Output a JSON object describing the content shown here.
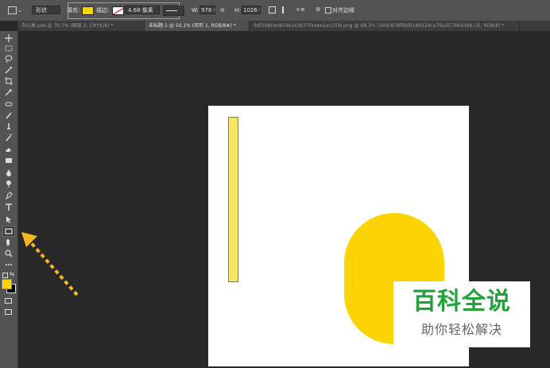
{
  "options_bar": {
    "shape_mode": "形状",
    "fill_label": "填充:",
    "fill_color": "#fcd404",
    "stroke_label": "描边:",
    "stroke_width": "4.68 像素",
    "w_label": "W:",
    "w_value": "978 像",
    "h_label": "H:",
    "h_value": "1026 像",
    "align_edges_label": "对齐边缘"
  },
  "tabs": [
    {
      "label": "办公桌.psd @ 70.7% (图层 2, CMYK/8) *",
      "active": false
    },
    {
      "label": "未标题-1 @ 50.1% (矩形 1, RGB/8#) *",
      "active": true
    },
    {
      "label": "9df298cbe854e163b37fa4ee1ec15fe.png @ 68.3% (393c678f96f918b524ca76a457494368 (3), RGB/8) *",
      "active": false
    }
  ],
  "tools": [
    "move-icon",
    "marquee-icon",
    "lasso-icon",
    "magic-wand-icon",
    "crop-icon",
    "eyedropper-icon",
    "healing-brush-icon",
    "brush-icon",
    "clone-stamp-icon",
    "history-brush-icon",
    "eraser-icon",
    "gradient-icon",
    "blur-icon",
    "dodge-icon",
    "pen-icon",
    "type-icon",
    "path-selection-icon",
    "rectangle-icon",
    "hand-icon",
    "zoom-icon",
    "more-icon"
  ],
  "colors": {
    "foreground": "#fcd404",
    "background": "#000000",
    "arrow": "#f5b820",
    "highlight": "#c9a227"
  },
  "watermark": {
    "title": "百科全说",
    "subtitle": "助你轻松解决"
  }
}
